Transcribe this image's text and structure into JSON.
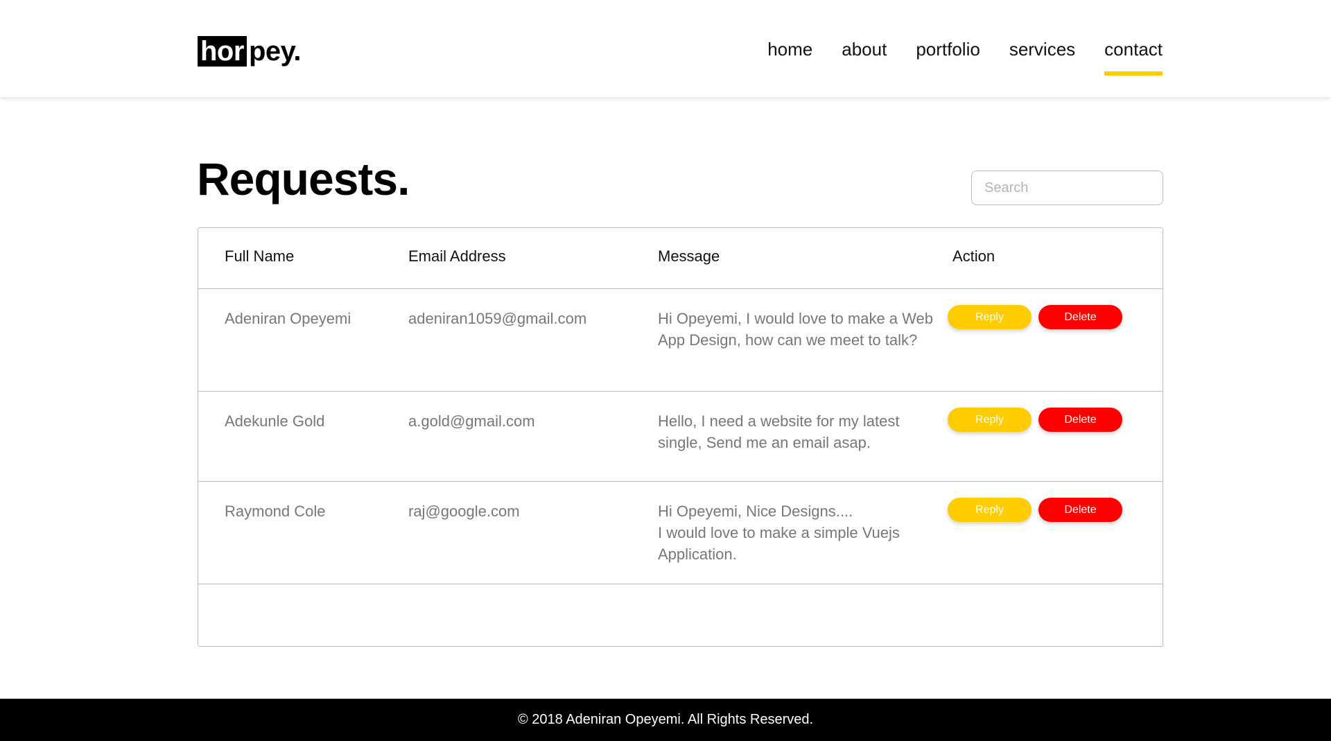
{
  "brand": {
    "logo_box": "hor",
    "logo_rest": "pey."
  },
  "nav": {
    "items": [
      {
        "label": "home"
      },
      {
        "label": "about"
      },
      {
        "label": "portfolio"
      },
      {
        "label": "services"
      },
      {
        "label": "contact",
        "active": true
      }
    ]
  },
  "page": {
    "title": "Requests.",
    "search_placeholder": "Search"
  },
  "table": {
    "columns": [
      "Full Name",
      "Email Address",
      "Message",
      "Action"
    ],
    "rows": [
      {
        "name": "Adeniran Opeyemi",
        "email": "adeniran1059@gmail.com",
        "message": "Hi Opeyemi, I would love to make a Web App Design, how can we meet to talk?"
      },
      {
        "name": "Adekunle Gold",
        "email": "a.gold@gmail.com",
        "message": "Hello, I need a website for my latest single, Send me an email asap."
      },
      {
        "name": "Raymond Cole",
        "email": "raj@google.com",
        "message": "Hi Opeyemi, Nice Designs....\nI would love to make a simple Vuejs Application."
      }
    ],
    "reply_label": "Reply",
    "delete_label": "Delete"
  },
  "footer": {
    "text": "© 2018 Adeniran Opeyemi. All Rights Reserved."
  },
  "colors": {
    "accent": "#ffcc00",
    "danger": "#ff0000",
    "footer_bg": "#000000"
  }
}
